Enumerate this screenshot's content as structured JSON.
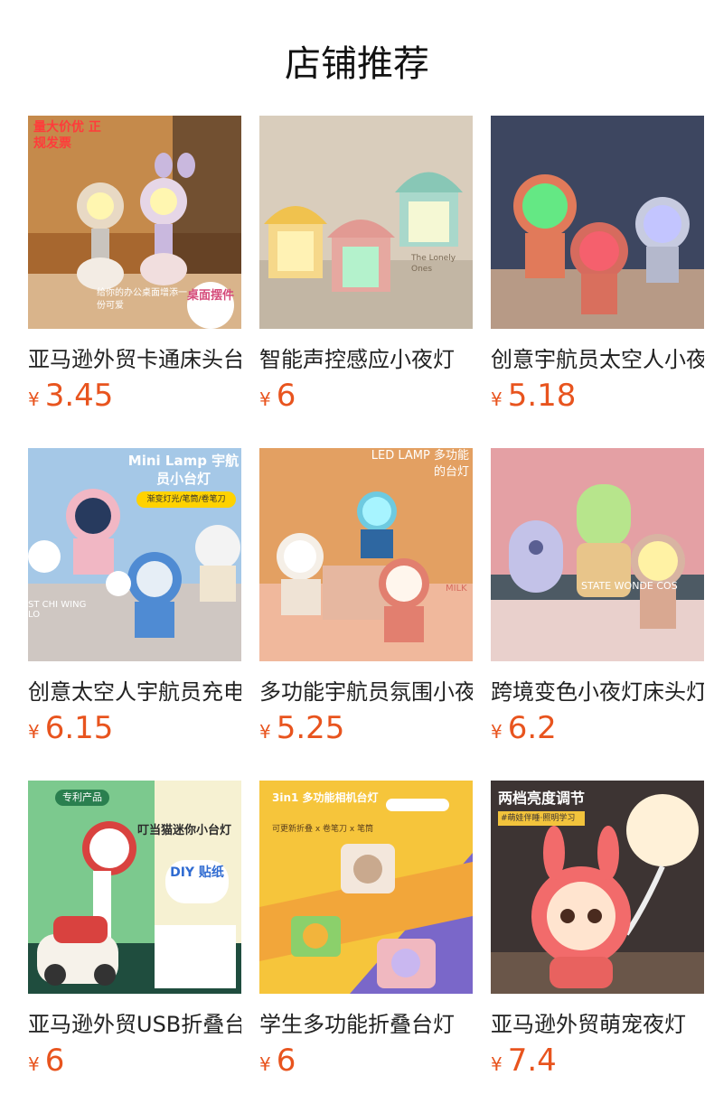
{
  "page_title": "店铺推荐",
  "currency": "¥",
  "accent_color": "#e8541e",
  "products": [
    {
      "name": "亚马逊外贸卡通床头台灯",
      "price": "3.45",
      "overlay_top": "量大价优 正规发票",
      "overlay_bottom": "给你的办公桌面增添一份可爱",
      "stamp": "桌面摆件"
    },
    {
      "name": "智能声控感应小夜灯",
      "price": "6",
      "overlay_top": "",
      "overlay_bottom": "The Lonely Ones"
    },
    {
      "name": "创意宇航员太空人小夜灯",
      "price": "5.18",
      "overlay_top": "",
      "overlay_bottom": ""
    },
    {
      "name": "创意太空人宇航员充电台灯",
      "price": "6.15",
      "overlay_top": "Mini Lamp 宇航员小台灯",
      "overlay_bottom": "渐变灯光/笔筒/卷笔刀",
      "side_text": "ST CHI WING LO"
    },
    {
      "name": "多功能宇航员氛围小夜灯",
      "price": "5.25",
      "overlay_top": "LED LAMP 多功能的台灯",
      "overlay_bottom": "",
      "side_text": "MILK"
    },
    {
      "name": "跨境变色小夜灯床头灯",
      "price": "6.2",
      "overlay_top": "",
      "overlay_bottom": "STATE WONDE COS"
    },
    {
      "name": "亚马逊外贸USB折叠台灯",
      "price": "6",
      "overlay_top": "专利产品",
      "overlay_bottom": "叮当猫迷你小台灯",
      "sticker": "DIY 贴纸"
    },
    {
      "name": "学生多功能折叠台灯",
      "price": "6",
      "overlay_top": "3in1 多功能相机台灯",
      "overlay_bottom": "可更新折叠 x 卷笔刀 x 笔筒"
    },
    {
      "name": "亚马逊外贸萌宠夜灯",
      "price": "7.4",
      "overlay_top": "两档亮度调节",
      "overlay_bottom": "#萌娃伴睡·照明学习"
    }
  ]
}
